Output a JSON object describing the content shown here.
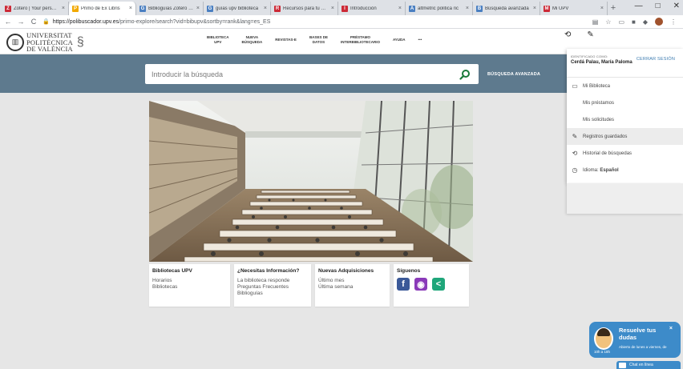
{
  "browser": {
    "tabs": [
      {
        "title": "Zotero | Your personal",
        "favicon_color": "#cc2936",
        "favicon_glyph": "Z",
        "active": false
      },
      {
        "title": "Primo de Ex Libris",
        "favicon_color": "#f2a900",
        "favicon_glyph": "P",
        "active": true
      },
      {
        "title": "Biblioguías Zotero - Bu",
        "favicon_color": "#4a7fc1",
        "favicon_glyph": "G",
        "active": false
      },
      {
        "title": "guías upv biblioteca",
        "favicon_color": "#4a7fc1",
        "favicon_glyph": "G",
        "active": false
      },
      {
        "title": "Recursos para tu TFG",
        "favicon_color": "#cc2936",
        "favicon_glyph": "R",
        "active": false
      },
      {
        "title": "Introducción",
        "favicon_color": "#cc2936",
        "favicon_glyph": "I",
        "active": false
      },
      {
        "title": "altmetric politica ric",
        "favicon_color": "#4a7fc1",
        "favicon_glyph": "A",
        "active": false
      },
      {
        "title": "Búsqueda avanzada",
        "favicon_color": "#4a7fc1",
        "favicon_glyph": "B",
        "active": false
      },
      {
        "title": "Mi UPV",
        "favicon_color": "#cc2936",
        "favicon_glyph": "M",
        "active": false
      }
    ],
    "new_tab": "+",
    "window_controls": [
      "—",
      "□",
      "✕"
    ],
    "url_host": "https://polibuscador.upv.es",
    "url_path": "/primo-explore/search?vid=bibupv&sortby=rank&lang=es_ES",
    "back": "←",
    "forward": "→",
    "reload": "C",
    "lock": "🔒",
    "extension_icons": [
      "▤",
      "☆",
      "▭",
      "■",
      "◆"
    ]
  },
  "site": {
    "logo_lines": [
      "UNIVERSITAT",
      "POLITÈCNICA",
      "DE VALÈNCIA"
    ],
    "nav": [
      "BIBLIOTECA\nUPV",
      "NUEVA\nBÚSQUEDA",
      "REVISTAS-E",
      "BASES DE\nDATOS",
      "PRÉSTAMO\nINTERBIBLIOTECARIO",
      "AYUDA",
      "•••"
    ],
    "header_icons": [
      "history-icon",
      "pin-icon"
    ]
  },
  "search": {
    "placeholder": "Introducir la búsqueda",
    "advanced_label": "BÚSQUEDA AVANZADA",
    "accent": "#1a7a3a"
  },
  "user_menu": {
    "identified_label": "IDENTIFICADO COMO:",
    "user_name": "Cerdá Palau, María Paloma",
    "logout_label": "CERRAR SESIÓN",
    "items": [
      {
        "label": "Mi Biblioteca",
        "icon": "library-card-icon",
        "sub": false,
        "highlight": false
      },
      {
        "label": "Mis préstamos",
        "icon": "",
        "sub": true,
        "highlight": false
      },
      {
        "label": "Mis solicitudes",
        "icon": "",
        "sub": true,
        "highlight": false
      },
      {
        "label": "Registros guardados",
        "icon": "pin-icon",
        "sub": false,
        "highlight": true
      },
      {
        "label": "Historial de búsquedas",
        "icon": "history-icon",
        "sub": false,
        "highlight": false
      }
    ],
    "language_label": "Idioma:",
    "language_value": "Español"
  },
  "cards": [
    {
      "title": "Bibliotecas UPV",
      "links": [
        "Horarios",
        "Bibliotecas"
      ]
    },
    {
      "title": "¿Necesitas Información?",
      "links": [
        "La biblioteca responde",
        "Preguntas Frecuentes",
        "Biblioguías"
      ]
    },
    {
      "title": "Nuevas Adquisiciones",
      "links": [
        "Último mes",
        "Última semana"
      ]
    },
    {
      "title": "Síguenos",
      "links": []
    }
  ],
  "social": [
    {
      "icon": "facebook-icon",
      "glyph": "f",
      "color": "#3b5998"
    },
    {
      "icon": "instagram-icon",
      "glyph": "◉",
      "color": "#8a3ab9"
    },
    {
      "icon": "share-icon",
      "glyph": "<",
      "color": "#1fa67a"
    }
  ],
  "chat": {
    "title": "Resuelve tus dudas",
    "hours": "Abierto de lunes a viernes, de",
    "range": "10h a 18h",
    "close": "×",
    "bar_label": "Chat en línea"
  }
}
